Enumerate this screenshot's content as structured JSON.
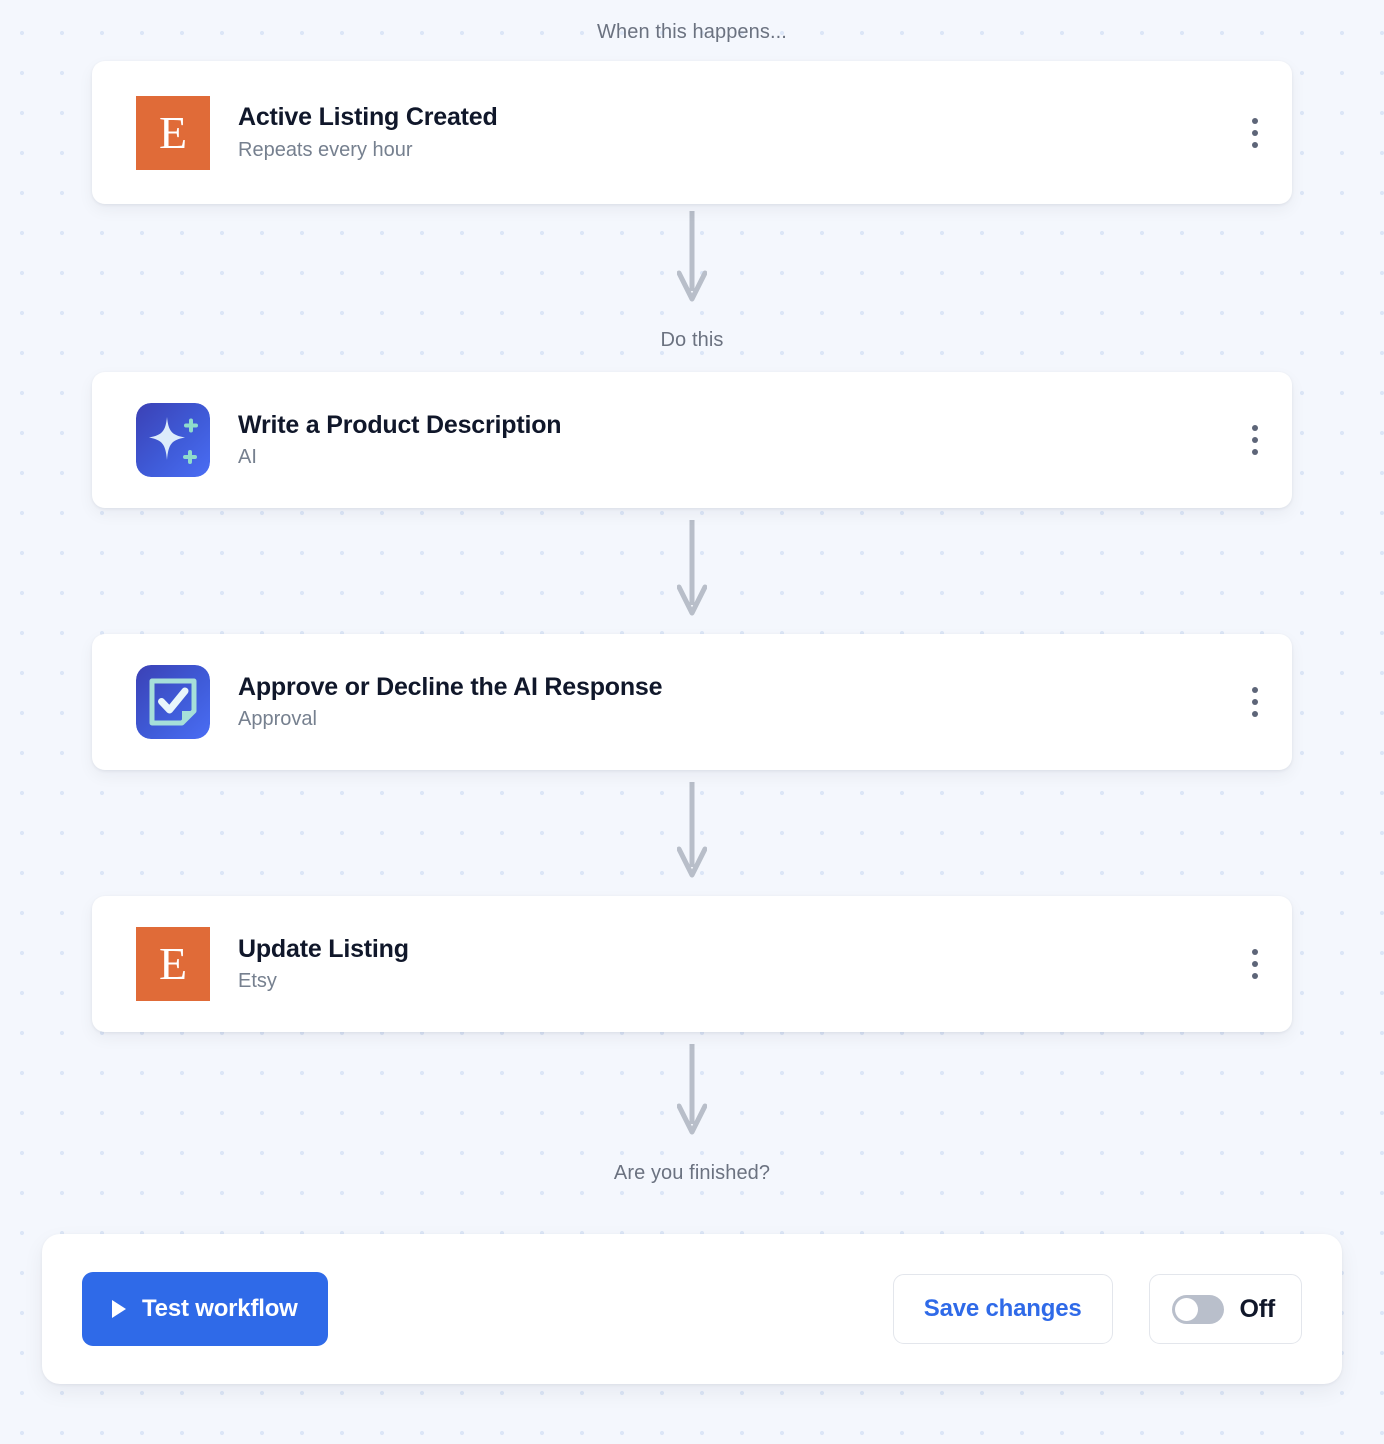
{
  "captions": {
    "trigger": "When this happens...",
    "action": "Do this",
    "finish": "Are you finished?"
  },
  "colors": {
    "accent_blue": "#2f6ae8",
    "etsy_orange": "#e06b38",
    "canvas_bg": "#f4f7fd",
    "dot_grid": "#dce6f7",
    "title_text": "#10172a",
    "subtitle_text": "#76808f"
  },
  "steps": [
    {
      "title": "Active Listing Created",
      "subtitle": "Repeats every hour",
      "icon": "etsy-logo-icon",
      "icon_letter": "E",
      "kind": "trigger",
      "has_drag_handle": false
    },
    {
      "title": "Write a Product Description",
      "subtitle": "AI",
      "icon": "ai-sparkle-icon",
      "kind": "step",
      "has_drag_handle": true
    },
    {
      "title": "Approve or Decline the AI Response",
      "subtitle": "Approval",
      "icon": "approval-checkdoc-icon",
      "kind": "step",
      "has_drag_handle": true
    },
    {
      "title": "Update Listing",
      "subtitle": "Etsy",
      "icon": "etsy-logo-icon",
      "icon_letter": "E",
      "kind": "step",
      "has_drag_handle": true
    }
  ],
  "action_bar": {
    "test_label": "Test workflow",
    "save_label": "Save changes",
    "toggle_label": "Off",
    "toggle_state": "off"
  }
}
